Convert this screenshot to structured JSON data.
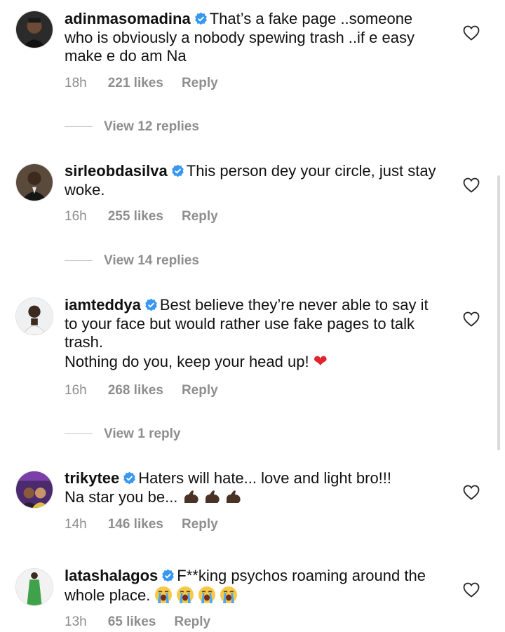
{
  "comments": [
    {
      "username": "adinmasomadina",
      "text": "That’s a fake page ..someone who is obviously a nobody spewing trash ..if e easy make e do am Na",
      "time": "18h",
      "likes": "221 likes",
      "reply": "Reply",
      "view_replies": "View 12 replies"
    },
    {
      "username": "sirleobdasilva",
      "text": "This person dey your circle, just stay woke.",
      "time": "16h",
      "likes": "255 likes",
      "reply": "Reply",
      "view_replies": "View 14 replies"
    },
    {
      "username": "iamteddya",
      "text": "Best believe they’re never able to say it to your face but would rather use fake pages to talk trash.",
      "text2": "Nothing do you, keep your head up!",
      "emoji": "❤",
      "time": "16h",
      "likes": "268 likes",
      "reply": "Reply",
      "view_replies": "View 1 reply"
    },
    {
      "username": "trikytee",
      "text": "Haters will hate... love and light bro!!!",
      "text2": "Na star you be...",
      "time": "14h",
      "likes": "146 likes",
      "reply": "Reply"
    },
    {
      "username": "latashalagos",
      "text": "F**king psychos roaming around the whole place.",
      "time": "13h",
      "likes": "65 likes",
      "reply": "Reply"
    }
  ],
  "colors": {
    "verified": "#3897f0",
    "meta": "#8e8e8e",
    "heart_emoji": "#e0242f"
  }
}
